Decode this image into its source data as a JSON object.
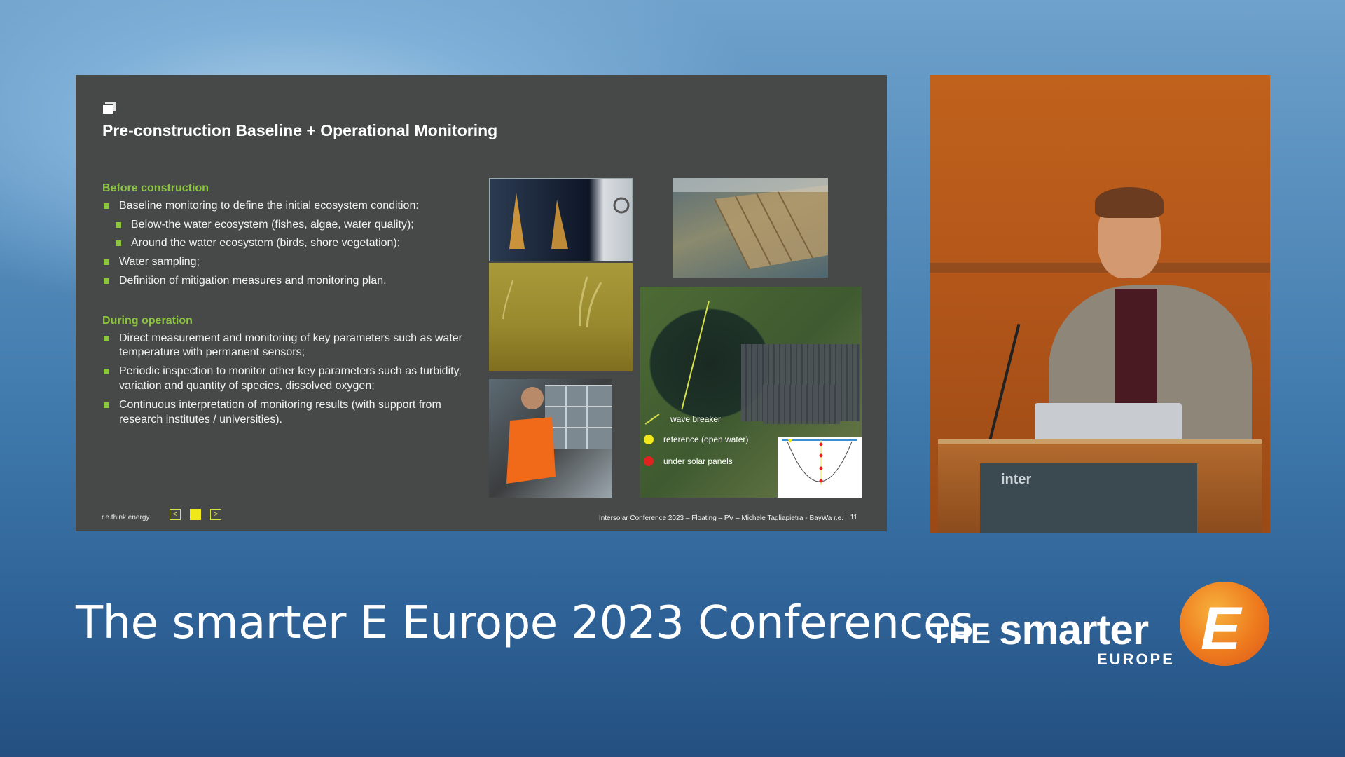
{
  "slide": {
    "title": "Pre-construction Baseline + Operational Monitoring",
    "before_heading": "Before construction",
    "before_bullets": [
      "Baseline monitoring to define the initial ecosystem condition:",
      "Below-the water ecosystem (fishes, algae, water quality);",
      "Around the water ecosystem (birds, shore vegetation);",
      "Water sampling;",
      "Definition of mitigation measures and monitoring plan."
    ],
    "during_heading": "During operation",
    "during_bullets": [
      "Direct measurement and monitoring of key parameters such as water temperature with permanent sensors;",
      "Periodic inspection to monitor other key parameters such as turbidity, variation and quantity of species, dissolved oxygen;",
      "Continuous interpretation of monitoring results (with support from research institutes / universities)."
    ],
    "legend": {
      "wave_breaker": "wave breaker",
      "reference": "reference (open water)",
      "under_panels": "under solar panels"
    },
    "footer": {
      "brand": "r.e.think energy",
      "credit": "Intersolar Conference 2023 – Floating – PV – Michele Tagliapietra - BayWa r.e.",
      "page_number": "11",
      "nav_prev": "<",
      "nav_next": ">"
    },
    "colors": {
      "accent_green": "#8dc63f",
      "accent_yellow": "#f1e81a",
      "legend_red": "#e0231f",
      "legend_yellow": "#f1e81a"
    }
  },
  "speaker": {
    "podium_text": "inter"
  },
  "banner": {
    "title": "The smarter E Europe 2023 Conferences",
    "brand_the": "THE",
    "brand_smarter": "smarter",
    "brand_europe": "EUROPE",
    "brand_e": "E"
  }
}
